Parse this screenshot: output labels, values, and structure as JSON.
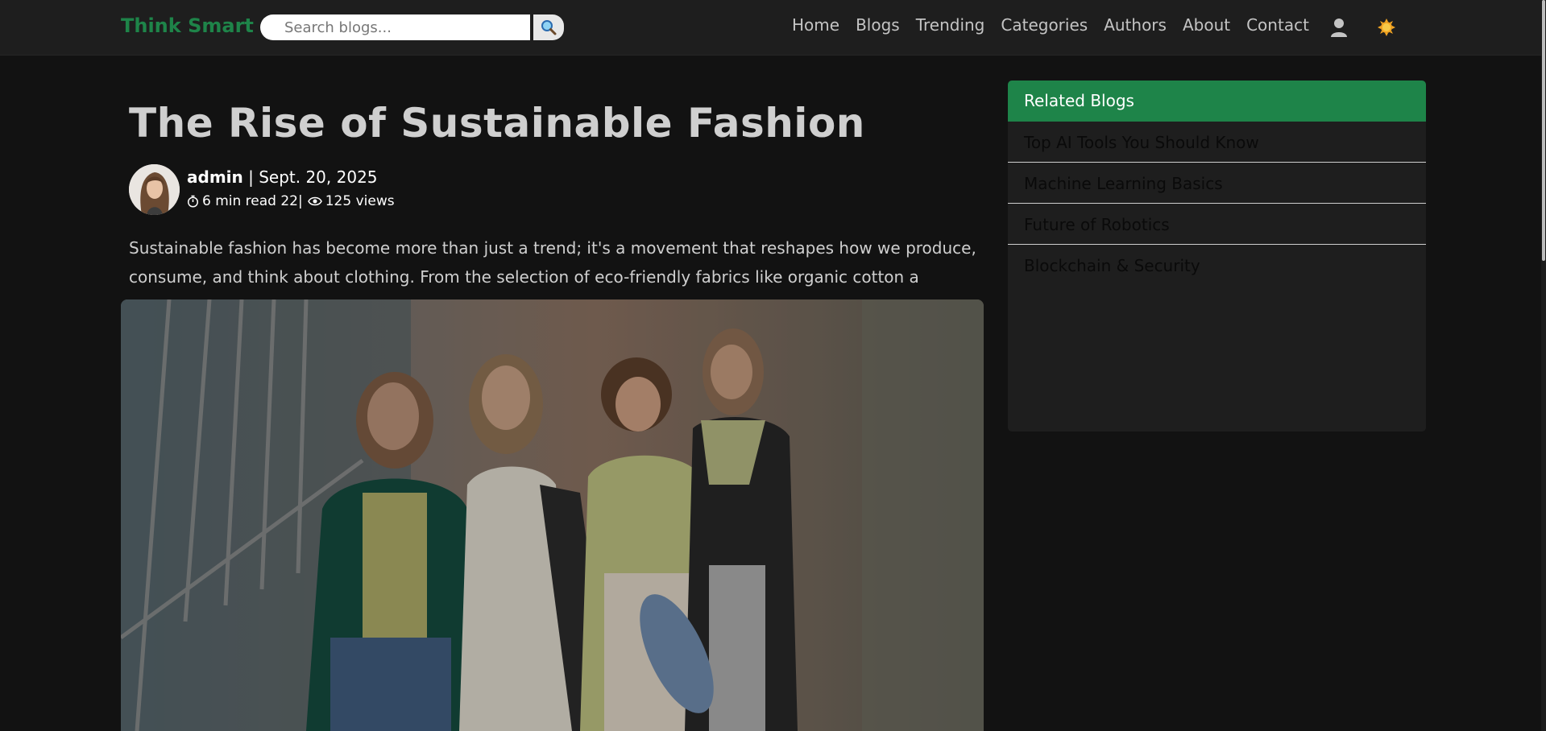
{
  "brand": {
    "name": "Think Smart",
    "color": "#1e8449"
  },
  "search": {
    "placeholder": "Search blogs...",
    "button_icon": "search-icon"
  },
  "nav": {
    "links": [
      "Home",
      "Blogs",
      "Trending",
      "Categories",
      "Authors",
      "About",
      "Contact"
    ],
    "user_icon": "user-icon",
    "theme_icon": "sun-icon"
  },
  "article": {
    "title": "The Rise of Sustainable Fashion",
    "author": "admin",
    "separator": " | ",
    "date": "Sept. 20, 2025",
    "read_time": "6 min read 22|",
    "views": "125 views",
    "excerpt": "Sustainable fashion has become more than just a trend; it's a movement that reshapes how we produce, consume, and think about clothing. From the selection of eco-friendly fabrics like organic cotton a"
  },
  "sidebar": {
    "header": "Related Blogs",
    "accent": "#1e8449",
    "items": [
      "Top AI Tools You Should Know",
      "Machine Learning Basics",
      "Future of Robotics",
      "Blockchain & Security"
    ]
  }
}
